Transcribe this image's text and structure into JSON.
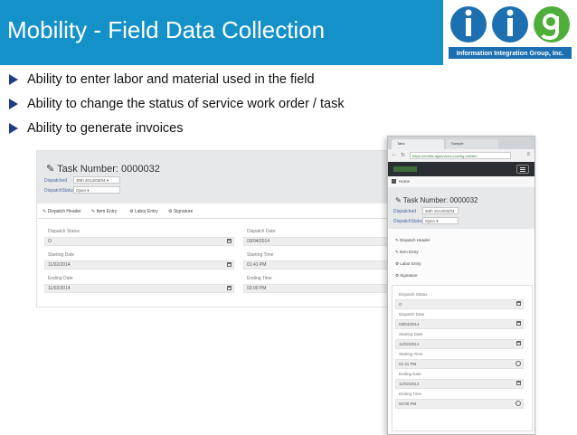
{
  "slide": {
    "title": "Mobility - Field Data Collection",
    "bullets": [
      "Ability to enter labor and material used in the field",
      "Ability to change the status of service work order / task",
      "Ability to generate invoices"
    ],
    "accent_color": "#1591c9",
    "bullet_color": "#1b3f86"
  },
  "logo": {
    "letters": [
      "i",
      "i",
      "g"
    ],
    "subtitle": "Information Integration Group, Inc.",
    "colors": {
      "blue": "#1c6fb0",
      "green": "#4fae3a"
    }
  },
  "desktop": {
    "task_title": "Task Number: 0000032",
    "dispatched_label": "Dispatched",
    "dispatched_value": "30th 2014/03/04",
    "dispatch_status_label": "DispatchStatus",
    "dispatch_status_value": "Open",
    "tabs": [
      "Dispatch Header",
      "Item Entry",
      "Labor Entry",
      "Signature"
    ],
    "fields": [
      {
        "label": "Dispatch Status",
        "value": "O",
        "icon": "calendar-icon"
      },
      {
        "label": "Dispatch Date",
        "value": "03/04/2014",
        "icon": "calendar-icon"
      },
      {
        "label": "Starting Date",
        "value": "11/02/2014",
        "icon": "calendar-icon"
      },
      {
        "label": "Starting Time",
        "value": "01:41 PM",
        "icon": "clock-icon"
      },
      {
        "label": "Ending Date",
        "value": "11/02/2014",
        "icon": "calendar-icon"
      },
      {
        "label": "Ending Time",
        "value": "02:00 PM",
        "icon": "clock-icon"
      }
    ]
  },
  "mobile": {
    "browser_tabs": [
      "Tabs",
      "Sample"
    ],
    "url": "https://mobile.iigservices.com/iig-mobile/",
    "breadcrumb": "Home",
    "task_title": "Task Number: 0000032",
    "dispatched_label": "Dispatched",
    "dispatched_value": "30th 2014/03/04",
    "dispatch_status_label": "DispatchStatus",
    "dispatch_status_value": "Open",
    "menu": [
      "Dispatch Header",
      "Item Entry",
      "Labor Entry",
      "Signature"
    ],
    "fields": [
      {
        "label": "Dispatch Status",
        "value": "O",
        "icon": "calendar-icon"
      },
      {
        "label": "Dispatch Date",
        "value": "03/04/2014",
        "icon": "calendar-icon"
      },
      {
        "label": "Starting Date",
        "value": "11/02/2014",
        "icon": "calendar-icon"
      },
      {
        "label": "Starting Time",
        "value": "01:41 PM",
        "icon": "clock-icon"
      },
      {
        "label": "Ending Date",
        "value": "11/02/2014",
        "icon": "calendar-icon"
      },
      {
        "label": "Ending Time",
        "value": "02:00 PM",
        "icon": "clock-icon"
      }
    ]
  }
}
